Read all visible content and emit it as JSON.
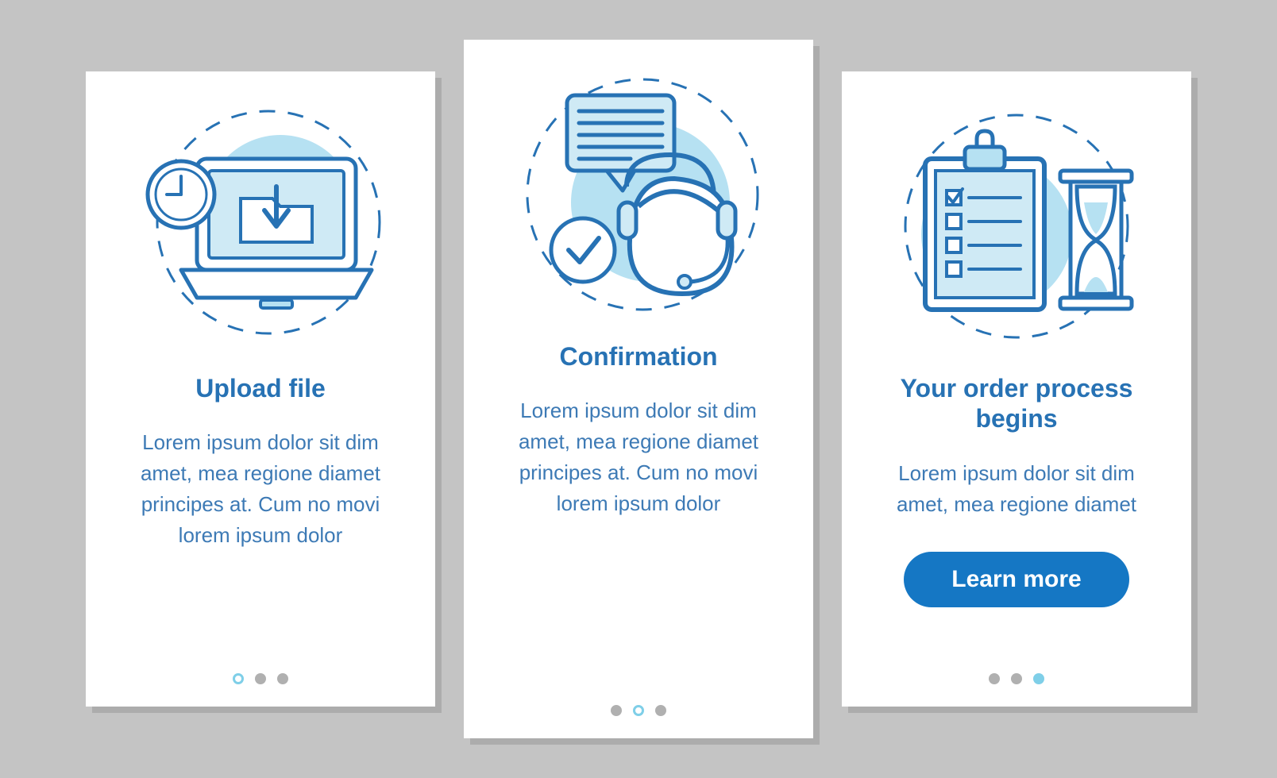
{
  "colors": {
    "primary": "#2772b4",
    "accent": "#7fcfe8",
    "light_blue": "#b6e1f2",
    "button": "#1577c4",
    "dot_inactive": "#b0b0b0",
    "bg": "#c4c4c4"
  },
  "cards": [
    {
      "title": "Upload file",
      "description": "Lorem ipsum dolor sit dim amet, mea regione diamet principes at. Cum no movi lorem ipsum dolor",
      "icon": "laptop-upload-clock-icon",
      "active_dot": 0,
      "has_button": false
    },
    {
      "title": "Confirmation",
      "description": "Lorem ipsum dolor sit dim amet, mea regione diamet principes at. Cum no movi lorem ipsum dolor",
      "icon": "support-agent-checkmark-icon",
      "active_dot": 1,
      "has_button": false
    },
    {
      "title": "Your order process begins",
      "description": "Lorem ipsum dolor sit dim amet, mea regione diamet",
      "icon": "clipboard-hourglass-icon",
      "active_dot": 2,
      "has_button": true,
      "button_label": "Learn more"
    }
  ]
}
